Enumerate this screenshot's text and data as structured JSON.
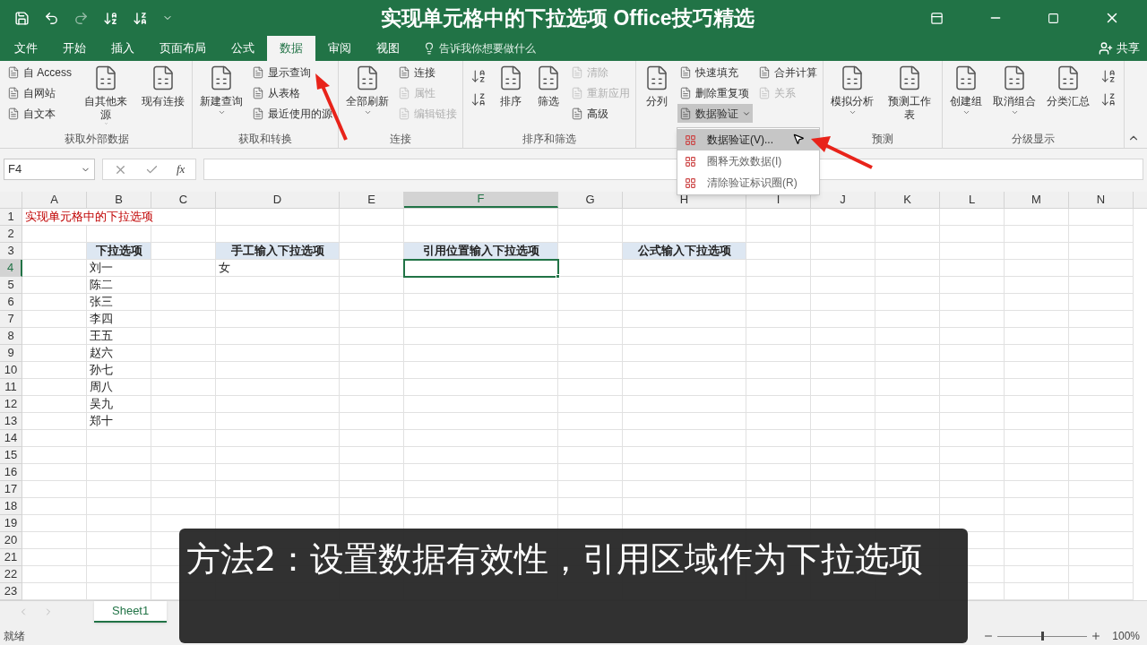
{
  "window": {
    "title": "实现单元格中的下拉选项 Office技巧精选"
  },
  "tabs": [
    {
      "label": "文件",
      "selected": false
    },
    {
      "label": "开始",
      "selected": false
    },
    {
      "label": "插入",
      "selected": false
    },
    {
      "label": "页面布局",
      "selected": false
    },
    {
      "label": "公式",
      "selected": false
    },
    {
      "label": "数据",
      "selected": true
    },
    {
      "label": "审阅",
      "selected": false
    },
    {
      "label": "视图",
      "selected": false
    }
  ],
  "tell_me": {
    "placeholder": "告诉我你想要做什么"
  },
  "share": "共享",
  "ribbon": [
    {
      "label": "获取外部数据",
      "columns": [
        {
          "kind": "stack",
          "items": [
            {
              "label": "自 Access",
              "disabled": false,
              "pressed": false
            },
            {
              "label": "自网站",
              "disabled": false,
              "pressed": false
            },
            {
              "label": "自文本",
              "disabled": false,
              "pressed": false
            }
          ]
        },
        {
          "kind": "large",
          "label": "自其他来源",
          "dropdown": true
        },
        {
          "kind": "large",
          "label": "现有连接",
          "dropdown": false
        }
      ]
    },
    {
      "label": "获取和转换",
      "columns": [
        {
          "kind": "large",
          "label": "新建查询",
          "dropdown": true
        },
        {
          "kind": "stack",
          "items": [
            {
              "label": "显示查询",
              "disabled": false,
              "pressed": false
            },
            {
              "label": "从表格",
              "disabled": false,
              "pressed": false
            },
            {
              "label": "最近使用的源",
              "disabled": false,
              "pressed": false
            }
          ]
        }
      ]
    },
    {
      "label": "连接",
      "columns": [
        {
          "kind": "large",
          "label": "全部刷新",
          "dropdown": true
        },
        {
          "kind": "stack",
          "items": [
            {
              "label": "连接",
              "disabled": false,
              "pressed": false
            },
            {
              "label": "属性",
              "disabled": true,
              "pressed": false
            },
            {
              "label": "编辑链接",
              "disabled": true,
              "pressed": false
            }
          ]
        }
      ]
    },
    {
      "label": "排序和筛选",
      "columns": [
        {
          "kind": "icons"
        },
        {
          "kind": "large",
          "label": "排序",
          "dropdown": false
        },
        {
          "kind": "large",
          "label": "筛选",
          "dropdown": false
        },
        {
          "kind": "stack",
          "items": [
            {
              "label": "清除",
              "disabled": true,
              "pressed": false
            },
            {
              "label": "重新应用",
              "disabled": true,
              "pressed": false
            },
            {
              "label": "高级",
              "disabled": false,
              "pressed": false
            }
          ]
        }
      ]
    },
    {
      "columns": [
        {
          "kind": "large",
          "label": "分列",
          "dropdown": false
        },
        {
          "kind": "stack",
          "items": [
            {
              "label": "快速填充",
              "disabled": false,
              "pressed": false
            },
            {
              "label": "删除重复项",
              "disabled": false,
              "pressed": false
            },
            {
              "label": "数据验证",
              "disabled": false,
              "pressed": true
            }
          ]
        },
        {
          "kind": "stack",
          "items": [
            {
              "label": "合并计算",
              "disabled": false,
              "pressed": false
            },
            {
              "label": "关系",
              "disabled": true,
              "pressed": false
            }
          ]
        }
      ]
    },
    {
      "label": "预测",
      "columns": [
        {
          "kind": "large",
          "label": "模拟分析",
          "dropdown": true
        },
        {
          "kind": "large",
          "label": "预测工作表",
          "dropdown": false
        }
      ]
    },
    {
      "label": "分级显示",
      "columns": [
        {
          "kind": "large",
          "label": "创建组",
          "dropdown": true
        },
        {
          "kind": "large",
          "label": "取消组合",
          "dropdown": true
        },
        {
          "kind": "large",
          "label": "分类汇总",
          "dropdown": false
        },
        {
          "kind": "icons"
        }
      ]
    }
  ],
  "menu": [
    {
      "label": "数据验证(V)...",
      "selected": true
    },
    {
      "label": "圈释无效数据(I)",
      "selected": false
    },
    {
      "label": "清除验证标识圈(R)",
      "selected": false
    }
  ],
  "formula_bar": {
    "name_box": "F4",
    "fx": "fx"
  },
  "columns": [
    {
      "label": "A",
      "selected": false
    },
    {
      "label": "B",
      "selected": false
    },
    {
      "label": "C",
      "selected": false
    },
    {
      "label": "D",
      "selected": false
    },
    {
      "label": "E",
      "selected": false
    },
    {
      "label": "F",
      "selected": true
    },
    {
      "label": "G",
      "selected": false
    },
    {
      "label": "H",
      "selected": false
    },
    {
      "label": "I",
      "selected": false
    },
    {
      "label": "J",
      "selected": false
    },
    {
      "label": "K",
      "selected": false
    },
    {
      "label": "L",
      "selected": false
    },
    {
      "label": "M",
      "selected": false
    },
    {
      "label": "N",
      "selected": false
    }
  ],
  "rows": [
    {
      "number": "1",
      "selected": false,
      "cells": {
        "A": {
          "text": "实现单元格中的下拉选项",
          "kind": "title"
        }
      }
    },
    {
      "number": "2",
      "selected": false
    },
    {
      "number": "3",
      "selected": false,
      "cells": {
        "B": {
          "text": "下拉选项",
          "kind": "header"
        },
        "D": {
          "text": "手工输入下拉选项",
          "kind": "header"
        },
        "F": {
          "text": "引用位置输入下拉选项",
          "kind": "header"
        },
        "H": {
          "text": "公式输入下拉选项",
          "kind": "header"
        }
      }
    },
    {
      "number": "4",
      "selected": true,
      "cells": {
        "B": {
          "text": "刘一",
          "kind": "plain"
        },
        "D": {
          "text": "女",
          "kind": "plain"
        }
      }
    },
    {
      "number": "5",
      "selected": false,
      "cells": {
        "B": {
          "text": "陈二",
          "kind": "plain"
        }
      }
    },
    {
      "number": "6",
      "selected": false,
      "cells": {
        "B": {
          "text": "张三",
          "kind": "plain"
        }
      }
    },
    {
      "number": "7",
      "selected": false,
      "cells": {
        "B": {
          "text": "李四",
          "kind": "plain"
        }
      }
    },
    {
      "number": "8",
      "selected": false,
      "cells": {
        "B": {
          "text": "王五",
          "kind": "plain"
        }
      }
    },
    {
      "number": "9",
      "selected": false,
      "cells": {
        "B": {
          "text": "赵六",
          "kind": "plain"
        }
      }
    },
    {
      "number": "10",
      "selected": false,
      "cells": {
        "B": {
          "text": "孙七",
          "kind": "plain"
        }
      }
    },
    {
      "number": "11",
      "selected": false,
      "cells": {
        "B": {
          "text": "周八",
          "kind": "plain"
        }
      }
    },
    {
      "number": "12",
      "selected": false,
      "cells": {
        "B": {
          "text": "吴九",
          "kind": "plain"
        }
      }
    },
    {
      "number": "13",
      "selected": false,
      "cells": {
        "B": {
          "text": "郑十",
          "kind": "plain"
        }
      }
    },
    {
      "number": "14",
      "selected": false
    },
    {
      "number": "15",
      "selected": false
    },
    {
      "number": "16",
      "selected": false
    },
    {
      "number": "17",
      "selected": false
    },
    {
      "number": "18",
      "selected": false
    },
    {
      "number": "19",
      "selected": false
    },
    {
      "number": "20",
      "selected": false
    },
    {
      "number": "21",
      "selected": false
    },
    {
      "number": "22",
      "selected": false
    },
    {
      "number": "23",
      "selected": false
    }
  ],
  "sheets": [
    {
      "label": "Sheet1",
      "selected": true
    }
  ],
  "status_bar": {
    "status": "就绪",
    "zoom": "100%",
    "level": 0.5
  },
  "caption": "方法2：设置数据有效性，引用区域作为下拉选项"
}
